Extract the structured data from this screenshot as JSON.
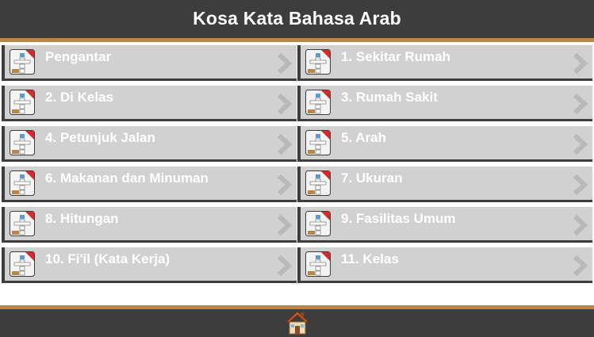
{
  "header": {
    "title": "Kosa Kata Bahasa Arab"
  },
  "menu": {
    "items": [
      {
        "label": "Pengantar"
      },
      {
        "label": "1. Sekitar Rumah"
      },
      {
        "label": "2. Di Kelas"
      },
      {
        "label": "3. Rumah Sakit"
      },
      {
        "label": "4. Petunjuk Jalan"
      },
      {
        "label": "5. Arah"
      },
      {
        "label": "6. Makanan dan Minuman"
      },
      {
        "label": "7. Ukuran"
      },
      {
        "label": "8. Hitungan"
      },
      {
        "label": "9. Fasilitas Umum"
      },
      {
        "label": "10. Fi'il (Kata Kerja)"
      },
      {
        "label": "11. Kelas"
      }
    ],
    "item_icon": "crossword-book-icon",
    "arrow_icon": "chevron-right-icon"
  },
  "footer": {
    "home_icon": "home-icon"
  },
  "colors": {
    "bar": "#3d3d3d",
    "accent": "#b98548",
    "item_background": "#d1d1d1",
    "text": "#ffffff"
  }
}
